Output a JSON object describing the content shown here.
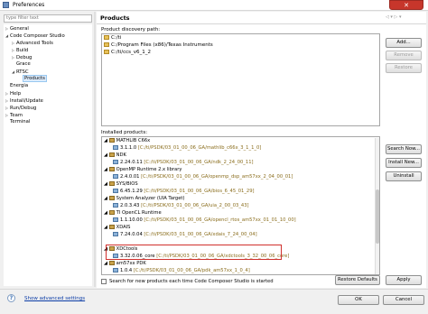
{
  "window": {
    "title": "Preferences",
    "close_glyph": "✕"
  },
  "filter": {
    "placeholder": "type filter text"
  },
  "tree": [
    {
      "label": "General",
      "twisty": "▷"
    },
    {
      "label": "Code Composer Studio",
      "twisty": "◢"
    },
    {
      "label": "Advanced Tools",
      "twisty": "▷"
    },
    {
      "label": "Build",
      "twisty": "▷"
    },
    {
      "label": "Debug",
      "twisty": "▷"
    },
    {
      "label": "Grace",
      "twisty": ""
    },
    {
      "label": "RTSC",
      "twisty": "◢"
    },
    {
      "label": "Products",
      "twisty": ""
    },
    {
      "label": "Energia",
      "twisty": ""
    },
    {
      "label": "Help",
      "twisty": "▷"
    },
    {
      "label": "Install/Update",
      "twisty": "▷"
    },
    {
      "label": "Run/Debug",
      "twisty": "▷"
    },
    {
      "label": "Team",
      "twisty": "▷"
    },
    {
      "label": "Terminal",
      "twisty": ""
    }
  ],
  "panel": {
    "title": "Products",
    "discovery_label": "Product discovery path:",
    "discovery_paths": [
      "C:/ti",
      "C:/Program Files (x86)/Texas Instruments",
      "C:/ti/ccs_v6_1_2"
    ],
    "buttons": {
      "add": "Add...",
      "remove": "Remove",
      "restore": "Restore"
    },
    "installed_label": "Installed products:",
    "installed_buttons": {
      "search": "Search Now...",
      "install": "Install New...",
      "uninstall": "Uninstall"
    },
    "installed": [
      {
        "kind": "pkg",
        "name": "MATHLIB C66x",
        "path": ""
      },
      {
        "kind": "ver",
        "name": "3.1.1.0",
        "path": "[C:/ti/PSDK/03_01_00_06_GA/mathlib_c66x_3_1_1_0]"
      },
      {
        "kind": "pkg",
        "name": "NDK",
        "path": ""
      },
      {
        "kind": "ver",
        "name": "2.24.0.11",
        "path": "[C:/ti/PSDK/03_01_00_06_GA/ndk_2_24_00_11]"
      },
      {
        "kind": "pkg",
        "name": "OpenMP Runtime 2.x library",
        "path": ""
      },
      {
        "kind": "ver",
        "name": "2.4.0.01",
        "path": "[C:/ti/PSDK/03_01_00_06_GA/openmp_dsp_am57xx_2_04_00_01]"
      },
      {
        "kind": "pkg",
        "name": "SYS/BIOS",
        "path": ""
      },
      {
        "kind": "ver",
        "name": "6.45.1.29",
        "path": "[C:/ti/PSDK/03_01_00_06_GA/bios_6_45_01_29]"
      },
      {
        "kind": "pkg",
        "name": "System Analyzer (UIA Target)",
        "path": ""
      },
      {
        "kind": "ver",
        "name": "2.0.3.43",
        "path": "[C:/ti/PSDK/03_01_00_06_GA/uia_2_00_03_43]"
      },
      {
        "kind": "pkg",
        "name": "TI OpenCL Runtime",
        "path": ""
      },
      {
        "kind": "ver",
        "name": "1.1.10.00",
        "path": "[C:/ti/PSDK/03_01_00_06_GA/opencl_rtos_am57xx_01_01_10_00]"
      },
      {
        "kind": "pkg",
        "name": "XDAIS",
        "path": ""
      },
      {
        "kind": "ver",
        "name": "7.24.0.04",
        "path": "[C:/ti/PSDK/03_01_00_06_GA/xdais_7_24_00_04]"
      },
      {
        "kind": "pkg",
        "name": "XDCtools",
        "path": ""
      },
      {
        "kind": "ver",
        "name": "3.32.0.06_core",
        "path": "[C:/ti/PSDK/03_01_00_06_GA/xdctools_3_32_00_06_core]"
      },
      {
        "kind": "pkg",
        "name": "am57xx PDK",
        "path": ""
      },
      {
        "kind": "ver",
        "name": "1.0.4",
        "path": "[C:/ti/PSDK/03_01_00_06_GA/pdk_am57xx_1_0_4]"
      }
    ],
    "checkbox_label": "Search for new products each time Code Composer Studio is started",
    "restore_defaults": "Restore Defaults",
    "apply": "Apply"
  },
  "footer": {
    "help_glyph": "?",
    "show_advanced": "Show advanced settings",
    "ok": "OK",
    "cancel": "Cancel"
  }
}
